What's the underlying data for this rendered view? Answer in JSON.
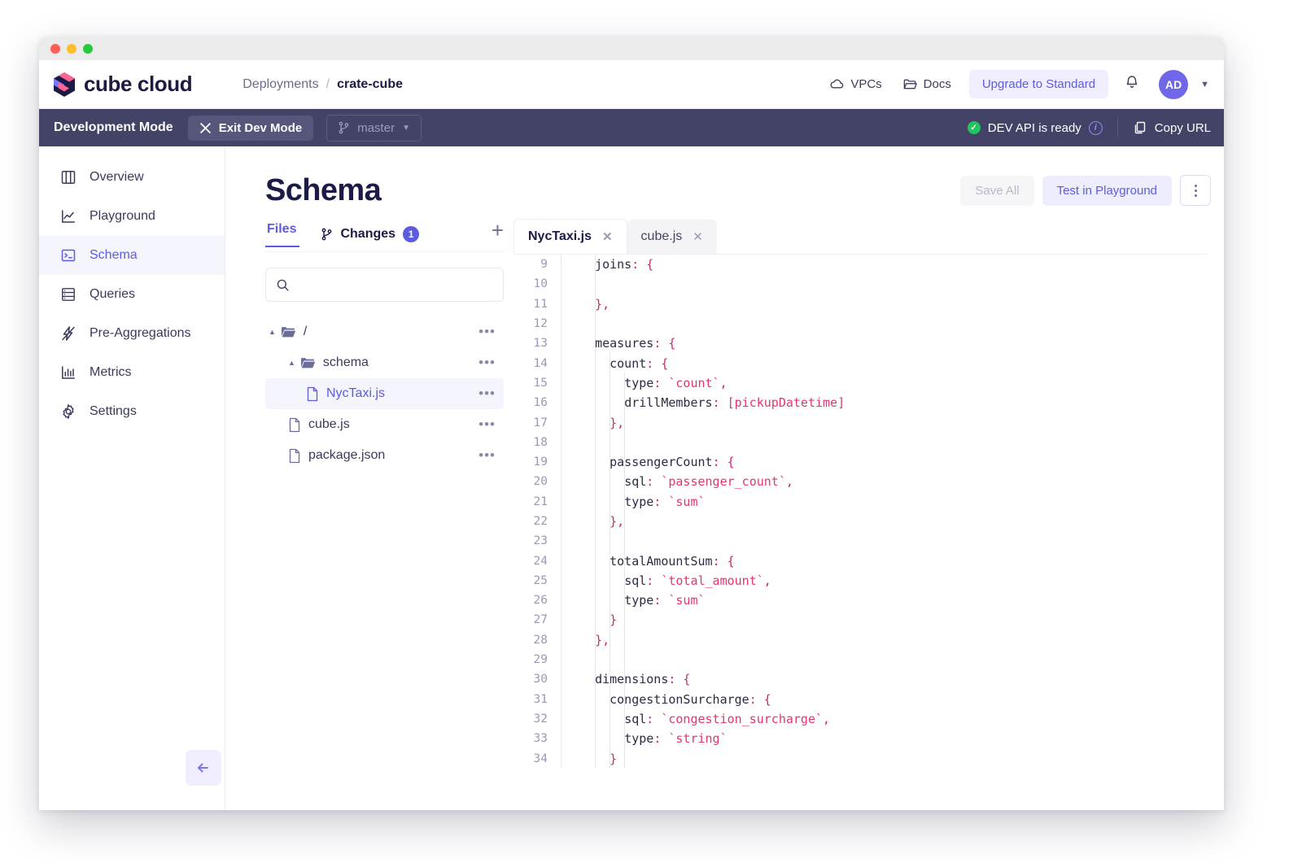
{
  "window": {
    "dots": [
      "red",
      "yellow",
      "green"
    ]
  },
  "header": {
    "brand": "cube cloud",
    "breadcrumb": {
      "parent": "Deployments",
      "separator": "/",
      "current": "crate-cube"
    },
    "actions": [
      {
        "label": "VPCs",
        "icon": "cloud-icon"
      },
      {
        "label": "Docs",
        "icon": "folder-icon"
      }
    ],
    "upgrade_label": "Upgrade to Standard",
    "avatar_initials": "AD"
  },
  "devbar": {
    "mode_label": "Development Mode",
    "exit_label": "Exit Dev Mode",
    "branch": "master",
    "api_status": "DEV API is ready",
    "copy_url_label": "Copy URL"
  },
  "sidebar": {
    "items": [
      {
        "label": "Overview",
        "icon": "layout-icon",
        "active": false
      },
      {
        "label": "Playground",
        "icon": "chart-line-icon",
        "active": false
      },
      {
        "label": "Schema",
        "icon": "terminal-icon",
        "active": true
      },
      {
        "label": "Queries",
        "icon": "server-icon",
        "active": false
      },
      {
        "label": "Pre-Aggregations",
        "icon": "bolt-icon",
        "active": false
      },
      {
        "label": "Metrics",
        "icon": "bar-chart-icon",
        "active": false
      },
      {
        "label": "Settings",
        "icon": "gear-icon",
        "active": false
      }
    ]
  },
  "page": {
    "title": "Schema",
    "save_all_label": "Save All",
    "test_playground_label": "Test in Playground"
  },
  "files_panel": {
    "tabs": [
      {
        "label": "Files",
        "active": true,
        "badge": null
      },
      {
        "label": "Changes",
        "active": false,
        "badge": "1"
      }
    ],
    "search_placeholder": "",
    "search_value": "",
    "tree": [
      {
        "label": "/",
        "type": "folder",
        "depth": 0,
        "expanded": true,
        "selected": false
      },
      {
        "label": "schema",
        "type": "folder",
        "depth": 1,
        "expanded": true,
        "selected": false
      },
      {
        "label": "NycTaxi.js",
        "type": "file",
        "depth": 2,
        "expanded": false,
        "selected": true
      },
      {
        "label": "cube.js",
        "type": "file",
        "depth": 1,
        "expanded": false,
        "selected": false
      },
      {
        "label": "package.json",
        "type": "file",
        "depth": 1,
        "expanded": false,
        "selected": false
      }
    ]
  },
  "editor": {
    "tabs": [
      {
        "label": "NycTaxi.js",
        "active": true
      },
      {
        "label": "cube.js",
        "active": false
      }
    ],
    "first_line_number": 9,
    "lines": [
      {
        "n": 9,
        "tokens": [
          {
            "t": "  ",
            "c": "plain"
          },
          {
            "t": "joins",
            "c": "plain"
          },
          {
            "t": ": {",
            "c": "punc"
          }
        ]
      },
      {
        "n": 10,
        "tokens": []
      },
      {
        "n": 11,
        "tokens": [
          {
            "t": "  ",
            "c": "plain"
          },
          {
            "t": "},",
            "c": "punc"
          }
        ]
      },
      {
        "n": 12,
        "tokens": []
      },
      {
        "n": 13,
        "tokens": [
          {
            "t": "  ",
            "c": "plain"
          },
          {
            "t": "measures",
            "c": "plain"
          },
          {
            "t": ": {",
            "c": "punc"
          }
        ]
      },
      {
        "n": 14,
        "tokens": [
          {
            "t": "    ",
            "c": "plain"
          },
          {
            "t": "count",
            "c": "plain"
          },
          {
            "t": ": {",
            "c": "punc"
          }
        ]
      },
      {
        "n": 15,
        "tokens": [
          {
            "t": "      ",
            "c": "plain"
          },
          {
            "t": "type",
            "c": "plain"
          },
          {
            "t": ": ",
            "c": "punc"
          },
          {
            "t": "`count`",
            "c": "str"
          },
          {
            "t": ",",
            "c": "punc"
          }
        ]
      },
      {
        "n": 16,
        "tokens": [
          {
            "t": "      ",
            "c": "plain"
          },
          {
            "t": "drillMembers",
            "c": "plain"
          },
          {
            "t": ": ",
            "c": "punc"
          },
          {
            "t": "[pickupDatetime]",
            "c": "bracket"
          }
        ]
      },
      {
        "n": 17,
        "tokens": [
          {
            "t": "    ",
            "c": "plain"
          },
          {
            "t": "},",
            "c": "punc"
          }
        ]
      },
      {
        "n": 18,
        "tokens": []
      },
      {
        "n": 19,
        "tokens": [
          {
            "t": "    ",
            "c": "plain"
          },
          {
            "t": "passengerCount",
            "c": "plain"
          },
          {
            "t": ": {",
            "c": "punc"
          }
        ]
      },
      {
        "n": 20,
        "tokens": [
          {
            "t": "      ",
            "c": "plain"
          },
          {
            "t": "sql",
            "c": "plain"
          },
          {
            "t": ": ",
            "c": "punc"
          },
          {
            "t": "`passenger_count`",
            "c": "str"
          },
          {
            "t": ",",
            "c": "punc"
          }
        ]
      },
      {
        "n": 21,
        "tokens": [
          {
            "t": "      ",
            "c": "plain"
          },
          {
            "t": "type",
            "c": "plain"
          },
          {
            "t": ": ",
            "c": "punc"
          },
          {
            "t": "`sum`",
            "c": "str"
          }
        ]
      },
      {
        "n": 22,
        "tokens": [
          {
            "t": "    ",
            "c": "plain"
          },
          {
            "t": "},",
            "c": "punc"
          }
        ]
      },
      {
        "n": 23,
        "tokens": []
      },
      {
        "n": 24,
        "tokens": [
          {
            "t": "    ",
            "c": "plain"
          },
          {
            "t": "totalAmountSum",
            "c": "plain"
          },
          {
            "t": ": {",
            "c": "punc"
          }
        ]
      },
      {
        "n": 25,
        "tokens": [
          {
            "t": "      ",
            "c": "plain"
          },
          {
            "t": "sql",
            "c": "plain"
          },
          {
            "t": ": ",
            "c": "punc"
          },
          {
            "t": "`total_amount`",
            "c": "str"
          },
          {
            "t": ",",
            "c": "punc"
          }
        ]
      },
      {
        "n": 26,
        "tokens": [
          {
            "t": "      ",
            "c": "plain"
          },
          {
            "t": "type",
            "c": "plain"
          },
          {
            "t": ": ",
            "c": "punc"
          },
          {
            "t": "`sum`",
            "c": "str"
          }
        ]
      },
      {
        "n": 27,
        "tokens": [
          {
            "t": "    ",
            "c": "plain"
          },
          {
            "t": "}",
            "c": "punc"
          }
        ]
      },
      {
        "n": 28,
        "tokens": [
          {
            "t": "  ",
            "c": "plain"
          },
          {
            "t": "},",
            "c": "punc"
          }
        ]
      },
      {
        "n": 29,
        "tokens": []
      },
      {
        "n": 30,
        "tokens": [
          {
            "t": "  ",
            "c": "plain"
          },
          {
            "t": "dimensions",
            "c": "plain"
          },
          {
            "t": ": {",
            "c": "punc"
          }
        ]
      },
      {
        "n": 31,
        "tokens": [
          {
            "t": "    ",
            "c": "plain"
          },
          {
            "t": "congestionSurcharge",
            "c": "plain"
          },
          {
            "t": ": {",
            "c": "punc"
          }
        ]
      },
      {
        "n": 32,
        "tokens": [
          {
            "t": "      ",
            "c": "plain"
          },
          {
            "t": "sql",
            "c": "plain"
          },
          {
            "t": ": ",
            "c": "punc"
          },
          {
            "t": "`congestion_surcharge`",
            "c": "str"
          },
          {
            "t": ",",
            "c": "punc"
          }
        ]
      },
      {
        "n": 33,
        "tokens": [
          {
            "t": "      ",
            "c": "plain"
          },
          {
            "t": "type",
            "c": "plain"
          },
          {
            "t": ": ",
            "c": "punc"
          },
          {
            "t": "`string`",
            "c": "str"
          }
        ]
      },
      {
        "n": 34,
        "tokens": [
          {
            "t": "    ",
            "c": "plain"
          },
          {
            "t": "}",
            "c": "punc"
          }
        ]
      }
    ]
  },
  "colors": {
    "accent": "#5e5cde",
    "devbar_bg": "#434367",
    "title": "#1b1b48",
    "status_ok": "#21c55d",
    "string": "#e5356e"
  }
}
